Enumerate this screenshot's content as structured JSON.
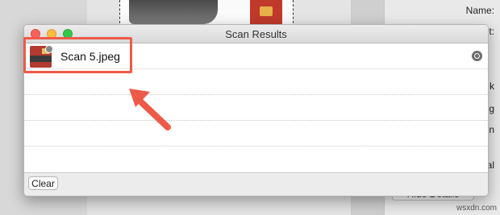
{
  "window": {
    "title": "Scan Results"
  },
  "results": [
    {
      "name": "Scan 5.jpeg",
      "thumbnail_icon": "image-thumbnail-icon",
      "action_icon": "magnifier-icon"
    }
  ],
  "footer": {
    "clear_label": "Clear"
  },
  "background_app": {
    "labels": [
      "Name:",
      "t:",
      "k",
      "g",
      "n",
      "al"
    ],
    "hide_details_label": "Hide Details"
  },
  "annotation": {
    "highlight_color": "#ee5a48",
    "arrow_color": "#ee5a48"
  },
  "watermark": "wsxdn.com",
  "colors": {
    "close": "#fc605c",
    "minimize": "#fdbc40",
    "maximize": "#34c84a"
  }
}
